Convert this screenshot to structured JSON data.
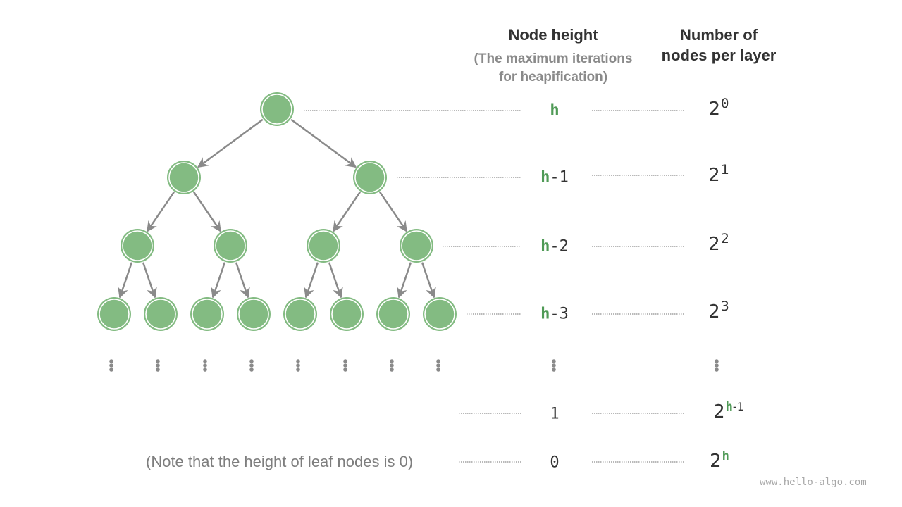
{
  "headers": {
    "node_height_title": "Node height",
    "node_height_subtitle_line1": "(The maximum iterations",
    "node_height_subtitle_line2": "for heapification)",
    "count_title_line1": "Number of",
    "count_title_line2": "nodes per layer"
  },
  "colors": {
    "node_fill": "#83bb82",
    "node_ring": "#83bb82",
    "edge": "#8a8a8a",
    "highlight_h": "#4f9a56",
    "text": "#333333",
    "muted_text": "#8a8a8a",
    "dotted_line": "#8f8f8f"
  },
  "tree": {
    "levels_drawn": 4,
    "level_node_counts": [
      1,
      2,
      4,
      8
    ],
    "ellipsis_below_leaves": 8
  },
  "rows": [
    {
      "height_prefix": "h",
      "height_suffix": "",
      "count_base": "2",
      "count_exp_h": "",
      "count_exp_rest": "0"
    },
    {
      "height_prefix": "h",
      "height_suffix": "-1",
      "count_base": "2",
      "count_exp_h": "",
      "count_exp_rest": "1"
    },
    {
      "height_prefix": "h",
      "height_suffix": "-2",
      "count_base": "2",
      "count_exp_h": "",
      "count_exp_rest": "2"
    },
    {
      "height_prefix": "h",
      "height_suffix": "-3",
      "count_base": "2",
      "count_exp_h": "",
      "count_exp_rest": "3"
    },
    {
      "height_prefix": "",
      "height_suffix": "1",
      "count_base": "2",
      "count_exp_h": "h",
      "count_exp_rest": "-1"
    },
    {
      "height_prefix": "",
      "height_suffix": "0",
      "count_base": "2",
      "count_exp_h": "h",
      "count_exp_rest": ""
    }
  ],
  "note": "(Note that the height of leaf nodes is 0)",
  "watermark": "www.hello-algo.com"
}
